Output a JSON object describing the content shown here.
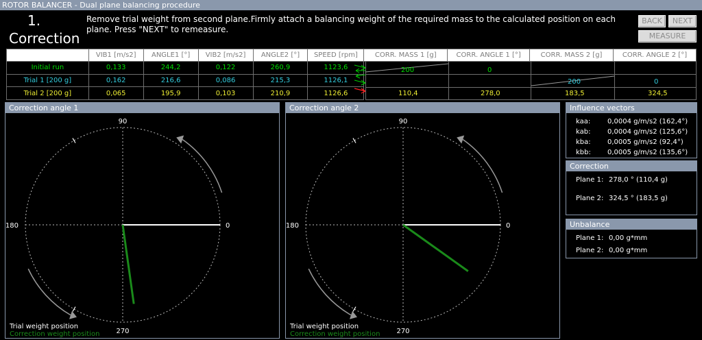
{
  "window": {
    "title": "ROTOR BALANCER - Dual plane balancing procedure"
  },
  "step": {
    "number": "1.",
    "name": "Correction"
  },
  "instructions": "Remove trial weight from second plane.Firmly attach a balancing weight of the required mass to the calculated position on each plane. Press \"NEXT\" to remeasure.",
  "buttons": {
    "back": "BACK",
    "next": "NEXT",
    "measure": "MEASURE"
  },
  "table": {
    "headers": [
      "VIB1 [m/s2]",
      "ANGLE1 [°]",
      "VIB2 [m/s2]",
      "ANGLE2 [°]",
      "SPEED [rpm]",
      "CORR. MASS 1 [g]",
      "CORR. ANGLE 1 [°]",
      "CORR. MASS 2 [g]",
      "CORR. ANGLE 2 [°]"
    ],
    "rows": [
      {
        "label": "Initial run",
        "color": "#00e000",
        "vib1": "0,133",
        "angle1": "244,2",
        "vib2": "0,122",
        "angle2": "260,9",
        "speed": "1123,6"
      },
      {
        "label": "Trial 1 [200 g]",
        "color": "#33ccdd",
        "vib1": "0,162",
        "angle1": "216,6",
        "vib2": "0,086",
        "angle2": "215,3",
        "speed": "1126,1"
      },
      {
        "label": "Trial 2 [200 g]",
        "color": "#eeee33",
        "vib1": "0,065",
        "angle1": "195,9",
        "vib2": "0,103",
        "angle2": "210,9",
        "speed": "1126,6"
      }
    ],
    "trial1_mass": "200",
    "trial1_angle": "0",
    "trial2_mass": "200",
    "trial2_angle": "0",
    "result": {
      "mass1": "110,4",
      "angle1": "278,0",
      "mass2": "183,5",
      "angle2": "324,5"
    }
  },
  "plots": [
    {
      "title": "Correction angle 1",
      "correction_angle_deg": 278.0
    },
    {
      "title": "Correction angle 2",
      "correction_angle_deg": 324.5
    }
  ],
  "polar": {
    "tick_90": "90",
    "tick_180": "180",
    "tick_0": "0",
    "tick_270": "270",
    "legend_trial": "Trial weight position",
    "legend_correction": "Correction weight position"
  },
  "influence": {
    "title": "Influence vectors",
    "items": [
      {
        "name": "kaa:",
        "value": "0,0004 g/m/s2  (162,4°)"
      },
      {
        "name": "kab:",
        "value": "0,0004 g/m/s2  (125,6°)"
      },
      {
        "name": "kba:",
        "value": "0,0005 g/m/s2  (92,4°)"
      },
      {
        "name": "kbb:",
        "value": "0,0005 g/m/s2  (135,6°)"
      }
    ]
  },
  "correction": {
    "title": "Correction",
    "plane1_label": "Plane 1:",
    "plane1_value": "278,0 ° (110,4 g)",
    "plane2_label": "Plane 2:",
    "plane2_value": "324,5 ° (183,5 g)"
  },
  "unbalance": {
    "title": "Unbalance",
    "plane1_label": "Plane 1:",
    "plane1_value": "0,00 g*mm",
    "plane2_label": "Plane 2:",
    "plane2_value": "0,00 g*mm"
  },
  "colors": {
    "accent": "#8a98ac",
    "initial": "#00e000",
    "trial1": "#33ccdd",
    "trial2": "#eeee33",
    "correction_line": "#1a8a1a",
    "arrow_red": "#ff2020"
  }
}
